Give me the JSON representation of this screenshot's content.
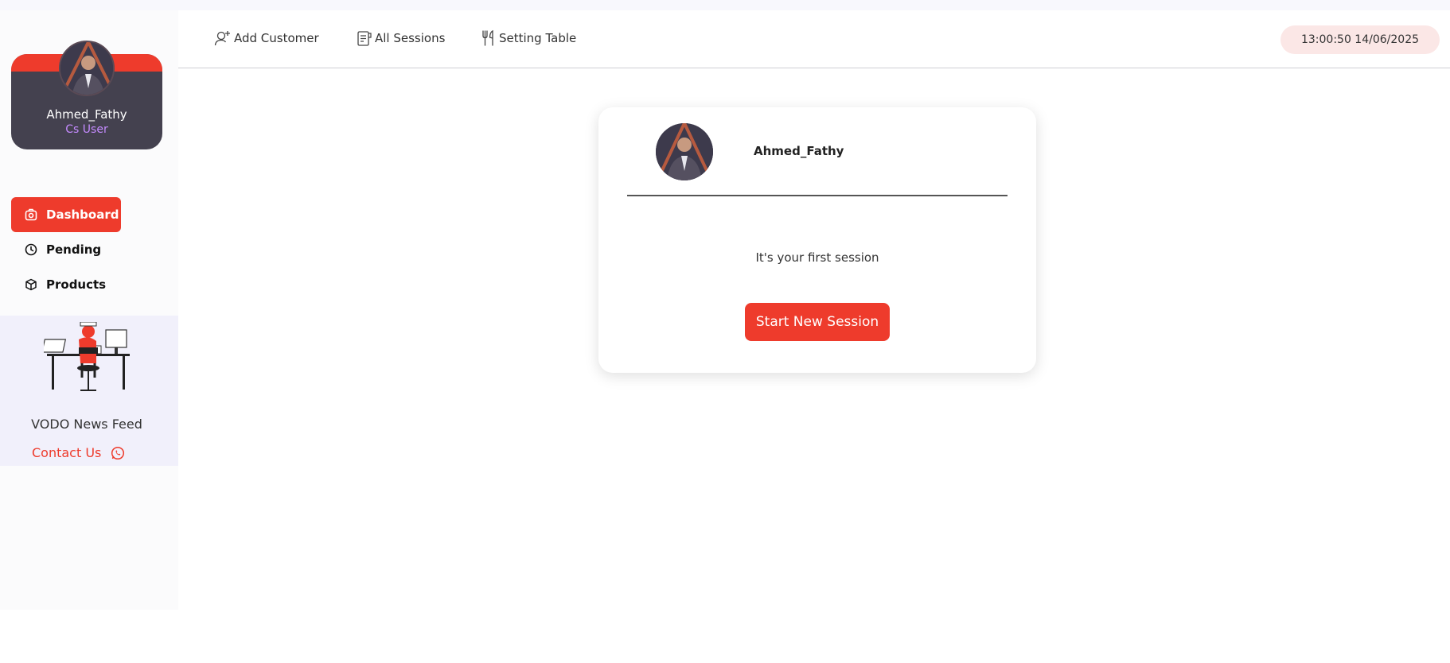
{
  "profile": {
    "name": "Ahmed_Fathy",
    "role": "Cs User"
  },
  "sidebar": {
    "items": [
      {
        "label": "Dashboard",
        "icon": "camera-icon",
        "active": true
      },
      {
        "label": "Pending",
        "icon": "clock-icon",
        "active": false
      },
      {
        "label": "Products",
        "icon": "box-icon",
        "active": false
      }
    ],
    "promo": {
      "title": "VODO News Feed",
      "contact_label": "Contact Us",
      "contact_icon": "whatsapp-icon"
    }
  },
  "topbar": {
    "items": [
      {
        "label": "Add Customer",
        "icon": "add-user-icon"
      },
      {
        "label": "All Sessions",
        "icon": "receipt-icon"
      },
      {
        "label": "Setting Table",
        "icon": "fork-knife-icon"
      }
    ],
    "clock": "13:00:50 14/06/2025"
  },
  "session_card": {
    "user_name": "Ahmed_Fathy",
    "message": "It's your first session",
    "button_label": "Start New Session"
  },
  "colors": {
    "accent": "#ee3b2c",
    "profile_bg": "#44414f",
    "role_text": "#c58bff",
    "promo_bg": "#f1f0fb",
    "clock_bg": "#fbe7e6"
  }
}
